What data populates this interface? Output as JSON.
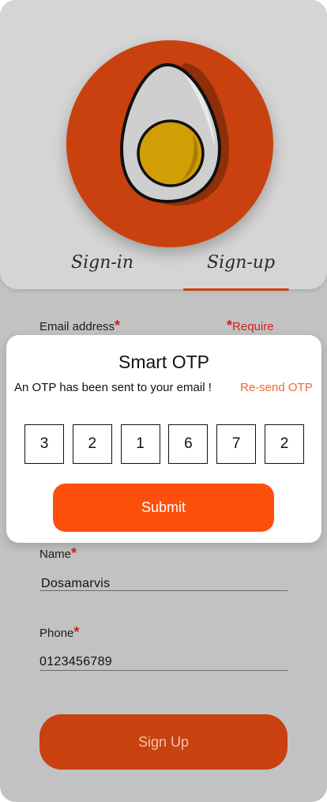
{
  "tabs": {
    "signin": "Sign-in",
    "signup": "Sign-up",
    "active": "signup"
  },
  "form": {
    "email_label": "Email address",
    "require_note": "Require",
    "required_mark": "*",
    "name_label": "Name",
    "name_value": "Dosamarvis",
    "phone_label": "Phone",
    "phone_value": "0123456789",
    "signup_button": "Sign Up"
  },
  "otp": {
    "title": "Smart OTP",
    "message": "An OTP has been sent to your email !",
    "resend": "Re-send OTP",
    "digits": [
      "3",
      "2",
      "1",
      "6",
      "7",
      "2"
    ],
    "submit": "Submit"
  },
  "colors": {
    "brand": "#c9410e",
    "submit": "#fc4f0c",
    "resend": "#ef6a2d",
    "required": "#d0201b",
    "background": "#c2c2c2"
  },
  "icons": {
    "logo": "boiled-egg-icon"
  }
}
